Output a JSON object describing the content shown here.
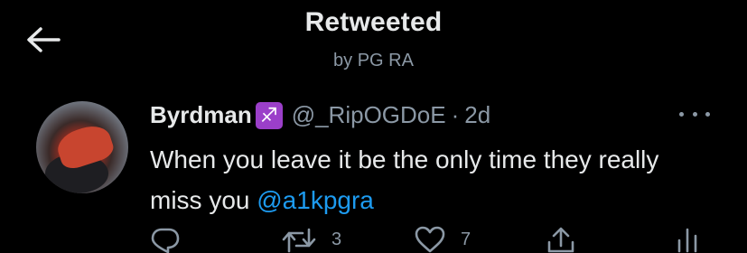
{
  "header": {
    "title": "Retweeted",
    "subtitle": "by PG RA"
  },
  "tweet": {
    "display_name": "Byrdman",
    "zodiac_emoji": "♐",
    "handle": "@_RipOGDoE",
    "separator": "·",
    "time": "2d",
    "text_main": "When you leave it be the only time they really miss you ",
    "mention": "@a1kpgra",
    "counts": {
      "retweets": "3",
      "likes": "7"
    }
  },
  "colors": {
    "background": "#000000",
    "text": "#e7e9ea",
    "secondary": "#8b98a5",
    "link": "#1d9bf0",
    "zodiac_bg": "#9b3fc9"
  },
  "icons": {
    "back": "arrow-left-icon",
    "more": "more-horizontal-icon",
    "reply": "reply-icon",
    "retweet": "retweet-icon",
    "like": "heart-icon",
    "share": "share-icon",
    "analytics": "analytics-icon"
  }
}
